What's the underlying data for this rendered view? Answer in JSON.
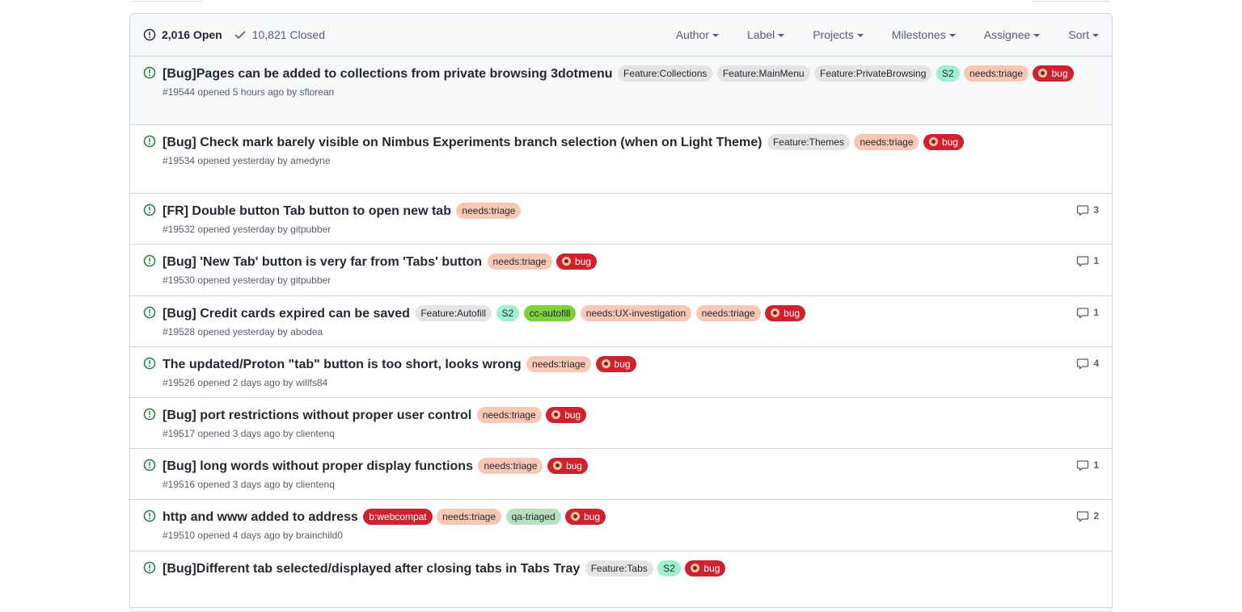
{
  "header": {
    "open_count": "2,016 Open",
    "closed_count": "10,821 Closed",
    "filters": [
      "Author",
      "Label",
      "Projects",
      "Milestones",
      "Assignee",
      "Sort"
    ]
  },
  "colors": {
    "open_icon": "#1a7f37",
    "muted_text": "#57606a",
    "border": "#d0d7de",
    "header_bg": "#f6f8fa"
  },
  "issues": [
    {
      "title": "[Bug]Pages can be added to collections from private browsing 3dotmenu",
      "labels": [
        {
          "text": "Feature:Collections",
          "bg": "#e4e4e4",
          "fg": "#24292f"
        },
        {
          "text": "Feature:MainMenu",
          "bg": "#e4e4e4",
          "fg": "#24292f"
        },
        {
          "text": "Feature:PrivateBrowsing",
          "bg": "#e4e4e4",
          "fg": "#24292f"
        },
        {
          "text": "S2",
          "bg": "#9ff0d0",
          "fg": "#24292f"
        },
        {
          "text": "needs:triage",
          "bg": "#f8c8b4",
          "fg": "#24292f"
        },
        {
          "text": "bug",
          "bg": "#cf222e",
          "fg": "#ffffff",
          "emoji": true
        }
      ],
      "number": "#19544",
      "opened": "opened 5 hours ago by",
      "author": "sflorean",
      "comments": ""
    },
    {
      "title": "[Bug] Check mark barely visible on Nimbus Experiments branch selection (when on Light Theme)",
      "labels": [
        {
          "text": "Feature:Themes",
          "bg": "#e4e4e4",
          "fg": "#24292f"
        },
        {
          "text": "needs:triage",
          "bg": "#f8c8b4",
          "fg": "#24292f"
        },
        {
          "text": "bug",
          "bg": "#cf222e",
          "fg": "#ffffff",
          "emoji": true
        }
      ],
      "number": "#19534",
      "opened": "opened yesterday by",
      "author": "amedyne",
      "comments": ""
    },
    {
      "title": "[FR] Double button Tab button to open new tab",
      "labels": [
        {
          "text": "needs:triage",
          "bg": "#f8c8b4",
          "fg": "#24292f"
        }
      ],
      "number": "#19532",
      "opened": "opened yesterday by",
      "author": "gitpubber",
      "comments": "3"
    },
    {
      "title": "[Bug] 'New Tab' button is very far from 'Tabs' button",
      "labels": [
        {
          "text": "needs:triage",
          "bg": "#f8c8b4",
          "fg": "#24292f"
        },
        {
          "text": "bug",
          "bg": "#cf222e",
          "fg": "#ffffff",
          "emoji": true
        }
      ],
      "number": "#19530",
      "opened": "opened yesterday by",
      "author": "gitpubber",
      "comments": "1"
    },
    {
      "title": "[Bug] Credit cards expired can be saved",
      "labels": [
        {
          "text": "Feature:Autofill",
          "bg": "#e4e4e4",
          "fg": "#24292f"
        },
        {
          "text": "S2",
          "bg": "#9ff0d0",
          "fg": "#24292f"
        },
        {
          "text": "cc-autofill",
          "bg": "#7ed13b",
          "fg": "#24292f"
        },
        {
          "text": "needs:UX-investigation",
          "bg": "#f8c8b4",
          "fg": "#24292f"
        },
        {
          "text": "needs:triage",
          "bg": "#f8c8b4",
          "fg": "#24292f"
        },
        {
          "text": "bug",
          "bg": "#cf222e",
          "fg": "#ffffff",
          "emoji": true
        }
      ],
      "number": "#19528",
      "opened": "opened yesterday by",
      "author": "abodea",
      "comments": "1"
    },
    {
      "title": "The updated/Proton \"tab\" button is too short, looks wrong",
      "labels": [
        {
          "text": "needs:triage",
          "bg": "#f8c8b4",
          "fg": "#24292f"
        },
        {
          "text": "bug",
          "bg": "#cf222e",
          "fg": "#ffffff",
          "emoji": true
        }
      ],
      "number": "#19526",
      "opened": "opened 2 days ago by",
      "author": "willfs84",
      "comments": "4"
    },
    {
      "title": "[Bug] port restrictions without proper user control",
      "labels": [
        {
          "text": "needs:triage",
          "bg": "#f8c8b4",
          "fg": "#24292f"
        },
        {
          "text": "bug",
          "bg": "#cf222e",
          "fg": "#ffffff",
          "emoji": true
        }
      ],
      "number": "#19517",
      "opened": "opened 3 days ago by",
      "author": "clientenq",
      "comments": ""
    },
    {
      "title": "[Bug] long words without proper display functions",
      "labels": [
        {
          "text": "needs:triage",
          "bg": "#f8c8b4",
          "fg": "#24292f"
        },
        {
          "text": "bug",
          "bg": "#cf222e",
          "fg": "#ffffff",
          "emoji": true
        }
      ],
      "number": "#19516",
      "opened": "opened 3 days ago by",
      "author": "clientenq",
      "comments": "1"
    },
    {
      "title": "http and www added to address",
      "labels": [
        {
          "text": "b:webcompat",
          "bg": "#cf222e",
          "fg": "#ffffff"
        },
        {
          "text": "needs:triage",
          "bg": "#f8c8b4",
          "fg": "#24292f"
        },
        {
          "text": "qa-triaged",
          "bg": "#b7e0c0",
          "fg": "#24292f"
        },
        {
          "text": "bug",
          "bg": "#cf222e",
          "fg": "#ffffff",
          "emoji": true
        }
      ],
      "number": "#19510",
      "opened": "opened 4 days ago by",
      "author": "brainchild0",
      "comments": "2"
    },
    {
      "title": "[Bug]Different tab selected/displayed after closing tabs in Tabs Tray",
      "labels": [
        {
          "text": "Feature:Tabs",
          "bg": "#e4e4e4",
          "fg": "#24292f"
        },
        {
          "text": "S2",
          "bg": "#9ff0d0",
          "fg": "#24292f"
        },
        {
          "text": "bug",
          "bg": "#cf222e",
          "fg": "#ffffff",
          "emoji": true
        }
      ],
      "number": "",
      "opened": "",
      "author": "",
      "comments": ""
    }
  ]
}
